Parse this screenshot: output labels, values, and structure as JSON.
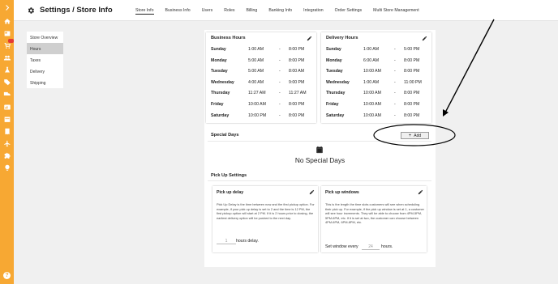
{
  "header": {
    "title": "Settings / Store Info",
    "tabs": [
      {
        "label": "Store Info",
        "active": true
      },
      {
        "label": "Business Info"
      },
      {
        "label": "Users"
      },
      {
        "label": "Roles"
      },
      {
        "label": "Billing"
      },
      {
        "label": "Banking Info"
      },
      {
        "label": "Integration"
      },
      {
        "label": "Order Settings"
      },
      {
        "label": "Multi Store Management"
      }
    ]
  },
  "subnav": {
    "items": [
      {
        "label": "Store Overview"
      },
      {
        "label": "Hours",
        "active": true
      },
      {
        "label": "Taxes"
      },
      {
        "label": "Delivery"
      },
      {
        "label": "Shipping"
      }
    ]
  },
  "business_hours": {
    "title": "Business Hours",
    "rows": [
      {
        "day": "Sunday",
        "open": "1:00 AM",
        "sep": "-",
        "close": "8:00 PM"
      },
      {
        "day": "Monday",
        "open": "5:00 AM",
        "sep": "-",
        "close": "8:00 PM"
      },
      {
        "day": "Tuesday",
        "open": "5:00 AM",
        "sep": "-",
        "close": "8:00 AM"
      },
      {
        "day": "Wednesday",
        "open": "4:00 AM",
        "sep": "-",
        "close": "9:00 PM"
      },
      {
        "day": "Thursday",
        "open": "11:27 AM",
        "sep": "-",
        "close": "11:27 AM"
      },
      {
        "day": "Friday",
        "open": "10:00 AM",
        "sep": "-",
        "close": "8:00 PM"
      },
      {
        "day": "Saturday",
        "open": "10:00 PM",
        "sep": "-",
        "close": "8:00 PM"
      }
    ]
  },
  "delivery_hours": {
    "title": "Delivery Hours",
    "rows": [
      {
        "day": "Sunday",
        "open": "1:00 AM",
        "sep": "-",
        "close": "5:00 PM"
      },
      {
        "day": "Monday",
        "open": "6:00 AM",
        "sep": "-",
        "close": "8:00 PM"
      },
      {
        "day": "Tuesday",
        "open": "10:00 AM",
        "sep": "-",
        "close": "8:00 PM"
      },
      {
        "day": "Wednesday",
        "open": "1:00 AM",
        "sep": "-",
        "close": "11:00 PM"
      },
      {
        "day": "Thursday",
        "open": "10:00 AM",
        "sep": "-",
        "close": "8:00 PM"
      },
      {
        "day": "Friday",
        "open": "10:00 AM",
        "sep": "-",
        "close": "8:00 PM"
      },
      {
        "day": "Saturday",
        "open": "10:00 AM",
        "sep": "-",
        "close": "8:00 PM"
      }
    ]
  },
  "special_days": {
    "title": "Special Days",
    "add_label": "Add",
    "empty_text": "No Special Days"
  },
  "pickup": {
    "title": "Pick Up Settings",
    "delay": {
      "title": "Pick up delay",
      "body": "Pick Up Delay is the time between now and the first pickup option. For example, if your pick up delay is set to 2 and the time is 12 PM, the first pickup option will start at 2 PM. If it is 2 hours prior to closing, the earliest delivery option will be pushed to the next day.",
      "value": "1",
      "suffix": "hours delay."
    },
    "windows": {
      "title": "Pick up windows",
      "body": "This is the length the time slots customers will see when scheduling their pick up. For example, if the pick up window is set at 1, a customer will see hour increments. They will be able to choose from 4PM-5PM, 5PM-6PM, etc. If it is set at two, the customer can choose between 4PM-6PM, 6PM-8PM, etc.",
      "prefix": "Set window every",
      "value": "24",
      "suffix": "hours."
    }
  },
  "colors": {
    "rail": "#f7a833",
    "badge": "#e53935"
  },
  "rail_icons": [
    "chevron-right-icon",
    "home-icon",
    "grid-icon",
    "cart-icon",
    "users-icon",
    "flask-icon",
    "tag-icon",
    "truck-icon",
    "reports-icon",
    "calendar-icon",
    "receipt-icon",
    "plane-icon",
    "puzzle-icon",
    "bulb-icon"
  ],
  "help_label": "?"
}
